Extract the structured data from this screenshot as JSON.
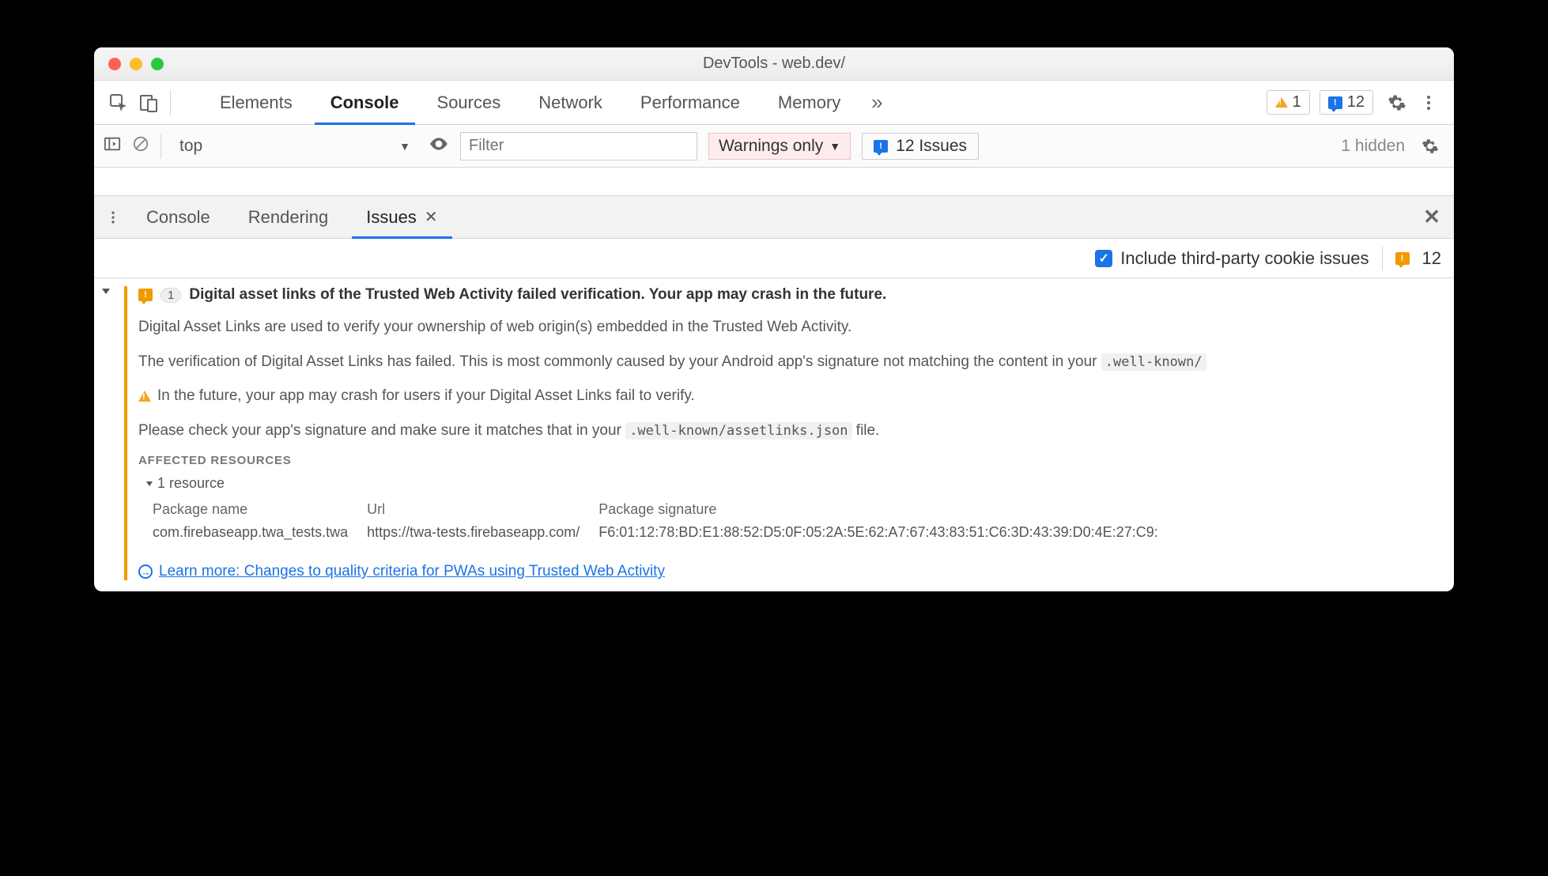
{
  "window": {
    "title": "DevTools - web.dev/"
  },
  "toolbar": {
    "tabs": [
      "Elements",
      "Console",
      "Sources",
      "Network",
      "Performance",
      "Memory"
    ],
    "active_tab": "Console",
    "overflow_glyph": "»",
    "warning_count": "1",
    "issue_count": "12"
  },
  "console_bar": {
    "context": "top",
    "filter_placeholder": "Filter",
    "level_label": "Warnings only",
    "issues_label": "12 Issues",
    "hidden_label": "1 hidden"
  },
  "drawer": {
    "tabs": [
      "Console",
      "Rendering",
      "Issues"
    ],
    "active_tab": "Issues"
  },
  "options": {
    "include_third_party_label": "Include third-party cookie issues",
    "total_count": "12"
  },
  "issue": {
    "count": "1",
    "title": "Digital asset links of the Trusted Web Activity failed verification. Your app may crash in the future.",
    "p1": "Digital Asset Links are used to verify your ownership of web origin(s) embedded in the Trusted Web Activity.",
    "p2_pre": "The verification of Digital Asset Links has failed. This is most commonly caused by your Android app's signature not matching the content in your ",
    "p2_code": ".well-known/",
    "p3": "In the future, your app may crash for users if your Digital Asset Links fail to verify.",
    "p4_pre": "Please check your app's signature and make sure it matches that in your ",
    "p4_code": ".well-known/assetlinks.json",
    "p4_post": " file.",
    "affected_heading": "Affected Resources",
    "resource_summary": "1 resource",
    "table_headers": [
      "Package name",
      "Url",
      "Package signature"
    ],
    "row": {
      "package": "com.firebaseapp.twa_tests.twa",
      "url": "https://twa-tests.firebaseapp.com/",
      "signature": "F6:01:12:78:BD:E1:88:52:D5:0F:05:2A:5E:62:A7:67:43:83:51:C6:3D:43:39:D0:4E:27:C9:"
    },
    "learn_more": "Learn more: Changes to quality criteria for PWAs using Trusted Web Activity"
  }
}
